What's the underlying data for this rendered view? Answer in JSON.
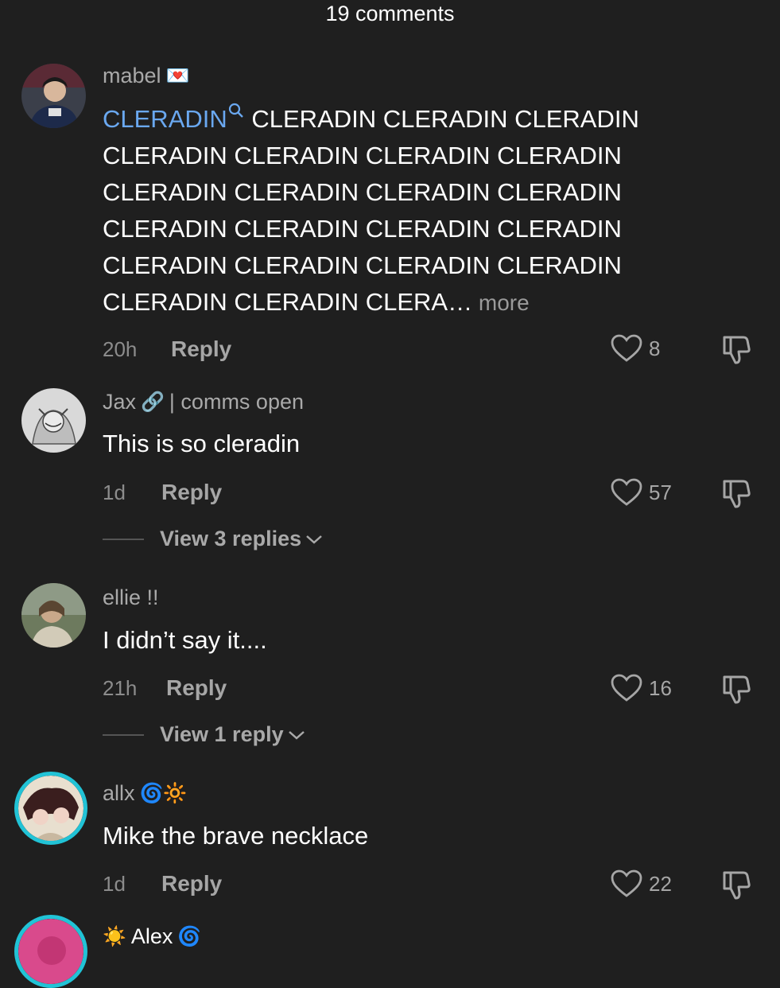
{
  "header": {
    "title": "19 comments"
  },
  "comments": [
    {
      "username": "mabel",
      "badge": "💌",
      "keyword": "CLERADIN",
      "text": " CLERADIN CLERADIN CLERADIN CLERADIN CLERADIN CLERADIN CLERADIN CLERADIN CLERADIN CLERADIN CLERADIN CLERADIN CLERADIN CLERADIN CLERADIN CLERADIN CLERADIN CLERADIN CLERADIN CLERADIN CLERADIN CLERA…",
      "more": " more",
      "time": "20h",
      "reply": "Reply",
      "likes": "8"
    },
    {
      "username": "Jax",
      "badge": "🔗",
      "suffix": "| comms open",
      "text": "This is so cleradin",
      "time": "1d",
      "reply": "Reply",
      "likes": "57",
      "view_replies": "View 3 replies"
    },
    {
      "username": "ellie !!",
      "text": "I didn’t say it....",
      "time": "21h",
      "reply": "Reply",
      "likes": "16",
      "view_replies": "View 1 reply"
    },
    {
      "username": "allx",
      "badge": "🌀🔆",
      "text": "Mike the brave necklace",
      "time": "1d",
      "reply": "Reply",
      "likes": "22"
    },
    {
      "username": "Alex",
      "badge_before": "☀️",
      "badge": "🌀"
    }
  ],
  "colors": {
    "background": "#1f1f1f",
    "keyword": "#6aa8f0",
    "story_ring": "#21c3d6"
  },
  "icons": [
    "heart-icon",
    "dislike-icon",
    "chevron-down-icon",
    "search-icon"
  ]
}
